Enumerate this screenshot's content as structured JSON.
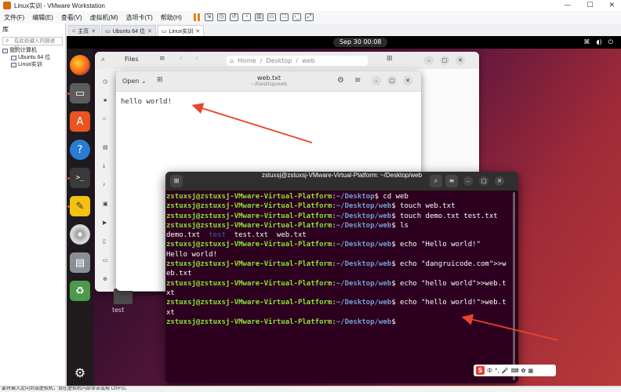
{
  "vmware": {
    "window_title": "Linux实训 - VMware Workstation",
    "controls": {
      "minimize": "—",
      "maximize": "☐",
      "close": "✕"
    },
    "menu": [
      "文件(F)",
      "编辑(E)",
      "查看(V)",
      "虚拟机(M)",
      "选项卡(T)",
      "帮助(H)"
    ],
    "library": {
      "title": "库",
      "search_placeholder": "在此处键入内容进行...",
      "tree": [
        "我的计算机",
        "Ubuntu 64 位",
        "Linux实训"
      ]
    },
    "tabs": [
      {
        "label": "主页",
        "active": false
      },
      {
        "label": "Ubuntu 64 位",
        "active": false
      },
      {
        "label": "Linux实训",
        "active": true
      }
    ],
    "statusbar": "要将输入定向到该虚拟机，请在虚拟机内部单击或按 Ctrl+G。"
  },
  "gnome": {
    "clock": "Sep 30  00:08",
    "status_icons": [
      "network-icon",
      "volume-icon",
      "power-icon"
    ],
    "dock": [
      "firefox",
      "files",
      "app-center",
      "help",
      "terminal",
      "text-editor",
      "disc",
      "disk-utility",
      "trash",
      "show-apps"
    ],
    "desktop_icon_label": "test"
  },
  "files": {
    "title": "Files",
    "breadcrumb": [
      "Home",
      "Desktop",
      "web"
    ]
  },
  "editor": {
    "open_label": "Open",
    "title": "web.txt",
    "subtitle": "~/Desktop/web",
    "content": "hello world!"
  },
  "terminal": {
    "title": "zstuxsj@zstuxsj-VMware-Virtual-Platform: ~/Desktop/web",
    "prompt_user": "zstuxsj@zstuxsj-VMware-Virtual-Platform",
    "lines": [
      {
        "path": "~/Desktop",
        "cmd": " cd web"
      },
      {
        "path": "~/Desktop/web",
        "cmd": " touch web.txt"
      },
      {
        "path": "~/Desktop/web",
        "cmd": " touch demo.txt test.txt"
      },
      {
        "path": "~/Desktop/web",
        "cmd": " ls"
      },
      {
        "output": "demo.txt  test  test.txt  web.txt"
      },
      {
        "path": "~/Desktop/web",
        "cmd": " echo \"Hello world!\""
      },
      {
        "output": "Hello world!"
      },
      {
        "path": "~/Desktop/web",
        "cmd": " echo \"dangruicode.com\">>w"
      },
      {
        "output": "eb.txt"
      },
      {
        "path": "~/Desktop/web",
        "cmd": " echo \"hello world\">>web.t"
      },
      {
        "output": "xt"
      },
      {
        "path": "~/Desktop/web",
        "cmd": " echo \"hello world!\">web.t"
      },
      {
        "output": "xt"
      },
      {
        "path": "~/Desktop/web",
        "cmd": ""
      }
    ]
  },
  "ime": {
    "logo": "S",
    "lang": "中"
  },
  "colors": {
    "prompt_user": "#8ae234",
    "prompt_path": "#729fcf",
    "terminal_bg": "#2c001e",
    "annotation_arrow": "#e8442e"
  }
}
